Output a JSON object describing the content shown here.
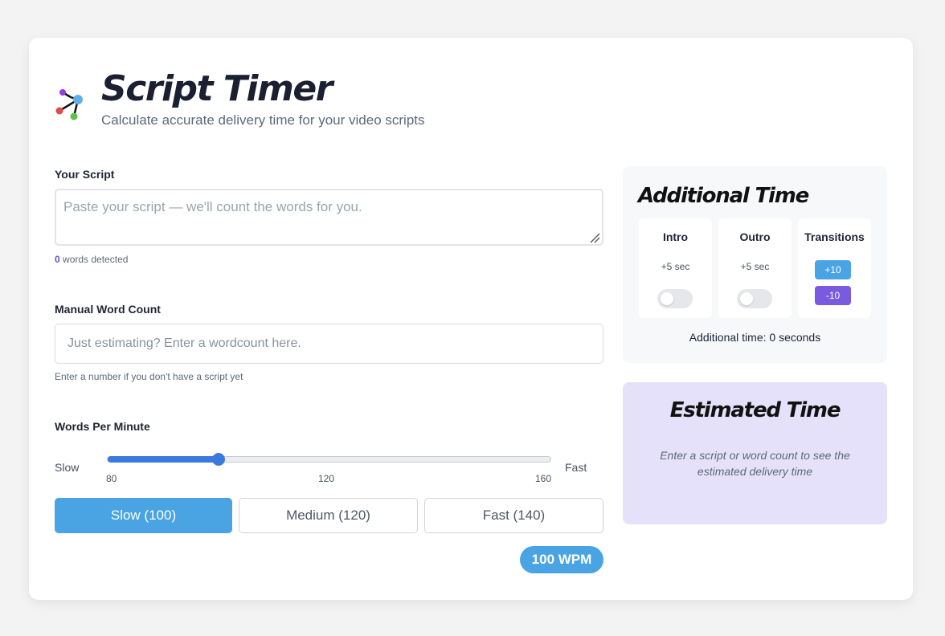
{
  "header": {
    "title": "Script Timer",
    "subtitle": "Calculate accurate delivery time for your video scripts"
  },
  "script": {
    "label": "Your Script",
    "placeholder": "Paste your script — we'll count the words for you.",
    "value": "",
    "word_count": "0",
    "words_detected_text": "words detected"
  },
  "manual": {
    "label": "Manual Word Count",
    "placeholder": "Just estimating? Enter a wordcount here.",
    "value": "",
    "hint": "Enter a number if you don't have a script yet"
  },
  "wpm": {
    "label": "Words Per Minute",
    "slow_label": "Slow",
    "fast_label": "Fast",
    "min": 80,
    "max": 160,
    "value": 100,
    "ticks": [
      "80",
      "120",
      "160"
    ],
    "presets": [
      {
        "label": "Slow (100)",
        "active": true
      },
      {
        "label": "Medium (120)",
        "active": false
      },
      {
        "label": "Fast (140)",
        "active": false
      }
    ],
    "badge": "100 WPM"
  },
  "additional": {
    "title": "Additional Time",
    "options": [
      {
        "title": "Intro",
        "sec": "+5 sec",
        "enabled": false
      },
      {
        "title": "Outro",
        "sec": "+5 sec",
        "enabled": false
      },
      {
        "title": "Transitions",
        "plus": "+10",
        "minus": "-10"
      }
    ],
    "summary": "Additional time: 0 seconds"
  },
  "estimate": {
    "title": "Estimated Time",
    "message": "Enter a script or word count to see the estimated delivery time"
  },
  "colors": {
    "accent_blue": "#4aa3e3",
    "slider_blue": "#3a7ae0",
    "accent_purple": "#7a5be0",
    "estimate_bg": "#e6e1fb"
  }
}
